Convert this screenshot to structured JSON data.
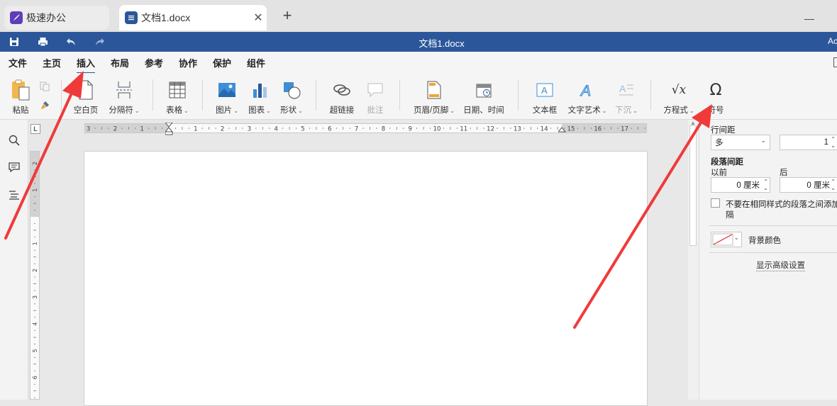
{
  "browser": {
    "tabs": [
      {
        "title": "极速办公",
        "icon": "rocket-icon",
        "color": "#5c3fb8"
      },
      {
        "title": "文档1.docx",
        "icon": "document-icon",
        "color": "#2b579a"
      }
    ],
    "close_glyph": "✕",
    "new_tab_glyph": "+",
    "minimize_glyph": "—"
  },
  "titlebar": {
    "title": "文档1.docx",
    "user": "Ac",
    "accent": "#2b579a"
  },
  "menu": {
    "items": [
      "文件",
      "主页",
      "插入",
      "布局",
      "参考",
      "协作",
      "保护",
      "组件"
    ],
    "active": "插入"
  },
  "ribbon": {
    "paste": "粘贴",
    "blank_page": "空白页",
    "page_break": "分隔符",
    "table": "表格",
    "picture": "图片",
    "chart": "图表",
    "shape": "形状",
    "hyperlink": "超链接",
    "comment": "批注",
    "header_footer": "页眉/页脚",
    "date_time": "日期、时间",
    "textbox": "文本框",
    "text_art": "文字艺术",
    "dropcap": "下沉",
    "equation": "方程式",
    "symbol": "符号",
    "equation_glyph": "√x",
    "symbol_glyph": "Ω",
    "caret": "⌄"
  },
  "ruler": {
    "corner": "L",
    "h_numbers": [
      "3",
      "2",
      "1",
      "1",
      "2",
      "3",
      "4",
      "5",
      "6",
      "7",
      "8",
      "9",
      "10",
      "11",
      "12",
      "13",
      "14",
      "15",
      "16",
      "17"
    ],
    "v_numbers": [
      "2",
      "1",
      "1",
      "2",
      "3",
      "4",
      "5",
      "6"
    ]
  },
  "panel": {
    "line_spacing_label": "行间距",
    "line_spacing_mode": "多",
    "line_spacing_value": "1",
    "para_spacing_label": "段落间距",
    "before_label": "以前",
    "after_label": "后",
    "before_value": "0 厘米",
    "after_value": "0 厘米",
    "no_space_same_style": "不要在相同样式的段落之间添加间",
    "no_space_same_style_2": "隔",
    "bg_color_label": "背景颜色",
    "advanced_link": "显示高级设置"
  },
  "annotations": {
    "arrow_color": "#f03a3a"
  }
}
